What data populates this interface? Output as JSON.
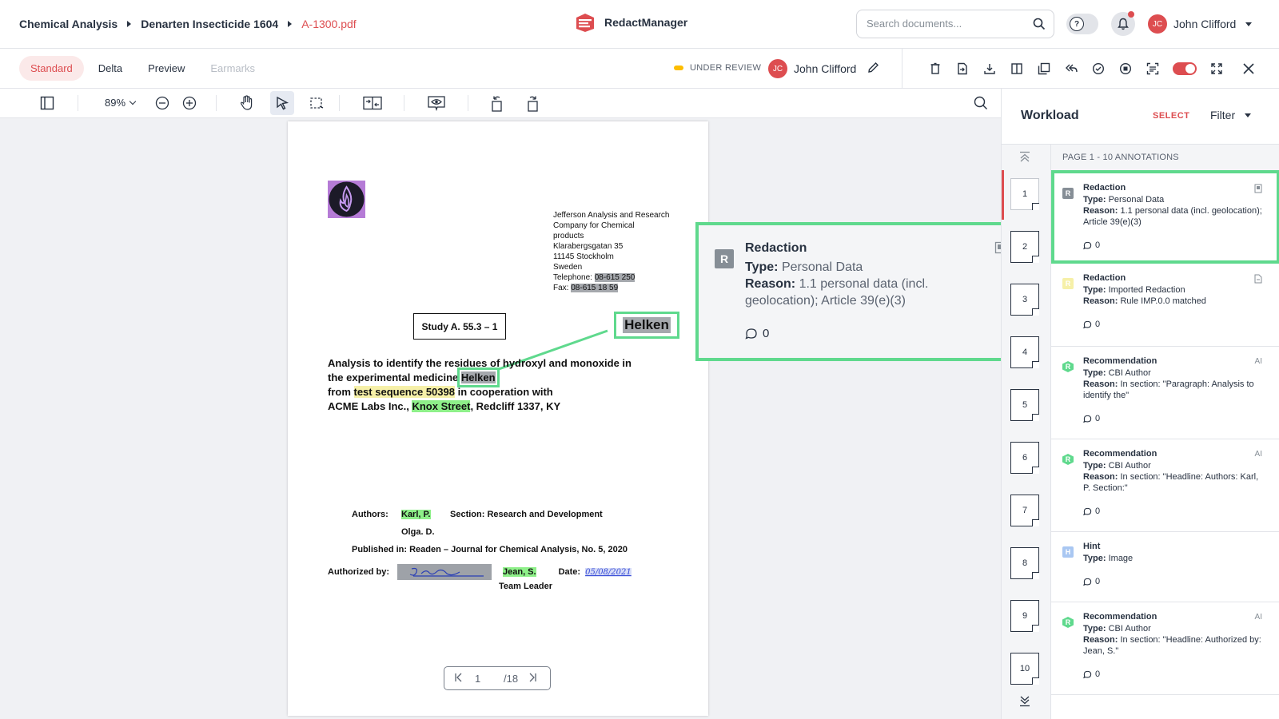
{
  "breadcrumb": {
    "items": [
      "Chemical Analysis",
      "Denarten Insecticide 1604"
    ],
    "current": "A-1300.pdf"
  },
  "app": {
    "name": "RedactManager"
  },
  "search": {
    "placeholder": "Search documents..."
  },
  "user": {
    "initials": "JC",
    "name": "John Clifford"
  },
  "view_tabs": [
    {
      "label": "Standard",
      "state": "active"
    },
    {
      "label": "Delta",
      "state": "normal"
    },
    {
      "label": "Preview",
      "state": "normal"
    },
    {
      "label": "Earmarks",
      "state": "disabled"
    }
  ],
  "status": {
    "label": "UNDER REVIEW",
    "color": "#fdbd00"
  },
  "assignee": {
    "initials": "JC",
    "name": "John Clifford"
  },
  "toolbar": {
    "zoom": "89%"
  },
  "document": {
    "address": [
      "Jefferson Analysis and Research",
      "Company for Chemical",
      "products",
      "Klarabergsgatan 35",
      "11145 Stockholm",
      "Sweden"
    ],
    "telephone_label": "Telephone:",
    "telephone_value": "08-615 250",
    "fax_label": "Fax:",
    "fax_value": "08-615 18 59",
    "study_title": "Study A. 55.3 – 1",
    "zoomed_term": "Helken",
    "body": {
      "line1": "Analysis to identify the residues of hydroxyl and monoxide in",
      "line2_pre": "the experimental medicine ",
      "line2_term": "Helken",
      "line3_pre": "from ",
      "line3_term": "test sequence 50398",
      "line3_post": " in cooperation with",
      "line4_pre": "ACME Labs Inc., ",
      "line4_term": "Knox Street",
      "line4_post": ", Redcliff 1337, KY"
    },
    "authors_label": "Authors:",
    "author1": "Karl, P.",
    "section": "Section: Research and Development",
    "author2": "Olga. D.",
    "published": "Published in: Readen – Journal for Chemical Analysis, No. 5, 2020",
    "authorized_label": "Authorized by:",
    "authorized_name": "Jean, S.",
    "date_label": "Date:",
    "date_value": "05/08/2021",
    "team_leader": "Team Leader",
    "signature_text": "J. Smith"
  },
  "pager": {
    "current": "1",
    "total": "/18"
  },
  "tooltip": {
    "badge": "R",
    "title": "Redaction",
    "type_label": "Type:",
    "type_value": "Personal Data",
    "reason_label": "Reason:",
    "reason_value": "1.1 personal data (incl. geolocation); Article 39(e)(3)",
    "comments": "0"
  },
  "panel": {
    "title": "Workload",
    "select": "SELECT",
    "filter": "Filter",
    "header": "PAGE 1 - 10 ANNOTATIONS",
    "pages": [
      "1",
      "2",
      "3",
      "4",
      "5",
      "6",
      "7",
      "8",
      "9",
      "10"
    ],
    "annotations": [
      {
        "badge": "R",
        "title": "Redaction",
        "type": "Personal Data",
        "reason": "1.1 personal data (incl. geolocation); Article 39(e)(3)",
        "comments": "0",
        "ai": ""
      },
      {
        "badge": "R",
        "title": "Redaction",
        "type": "Imported Redaction",
        "reason": "Rule IMP.0.0 matched",
        "comments": "0",
        "ai": ""
      },
      {
        "badge": "R",
        "title": "Recommendation",
        "type": "CBI Author",
        "reason": "In section: \"Paragraph: Analysis to identify the\"",
        "comments": "0",
        "ai": "AI"
      },
      {
        "badge": "R",
        "title": "Recommendation",
        "type": "CBI Author",
        "reason": "In section: \"Headline: Authors: Karl, P. Section:\"",
        "comments": "0",
        "ai": "AI"
      },
      {
        "badge": "H",
        "title": "Hint",
        "type": "Image",
        "reason": "",
        "comments": "0",
        "ai": ""
      },
      {
        "badge": "R",
        "title": "Recommendation",
        "type": "CBI Author",
        "reason": "In section: \"Headline: Authorized by: Jean, S.\"",
        "comments": "0",
        "ai": "AI"
      }
    ],
    "type_label": "Type:",
    "reason_label": "Reason:"
  },
  "colors": {
    "accent": "#dd4d50",
    "highlight_green": "#8ef089",
    "selection": "#5fd98d",
    "redaction_gray": "#a5a8ad"
  }
}
